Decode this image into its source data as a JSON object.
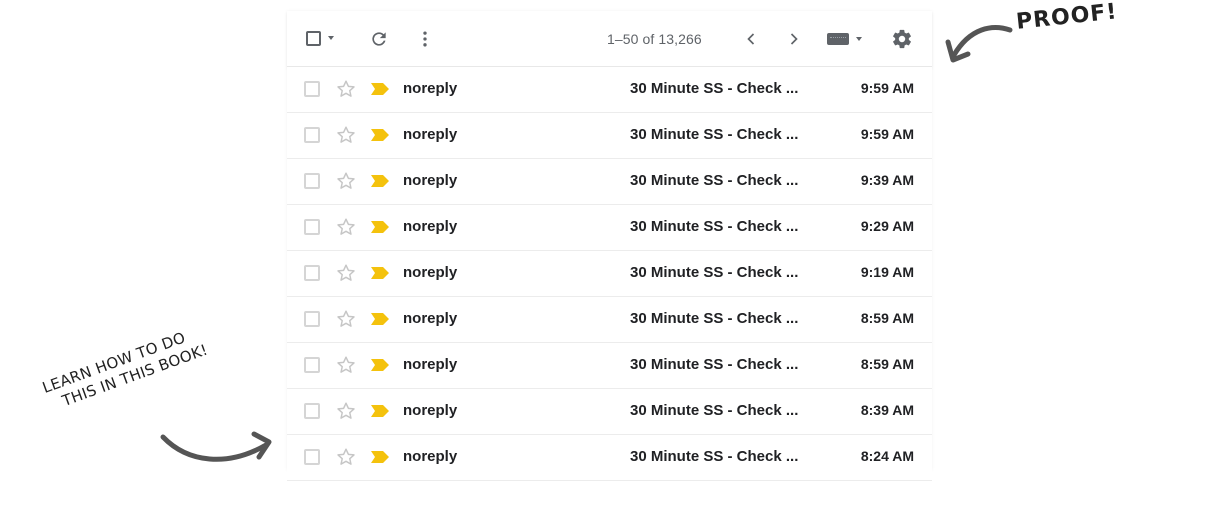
{
  "toolbar": {
    "page_count": "1–50 of 13,266",
    "icons": [
      "checkbox-icon",
      "dropdown-caret-icon",
      "refresh-icon",
      "more-vert-icon",
      "chevron-left-icon",
      "chevron-right-icon",
      "keyboard-icon",
      "gear-icon"
    ]
  },
  "emails": [
    {
      "sender": "noreply",
      "subject": "30 Minute SS - Check ...",
      "time": "9:59 AM"
    },
    {
      "sender": "noreply",
      "subject": "30 Minute SS - Check ...",
      "time": "9:59 AM"
    },
    {
      "sender": "noreply",
      "subject": "30 Minute SS - Check ...",
      "time": "9:39 AM"
    },
    {
      "sender": "noreply",
      "subject": "30 Minute SS - Check ...",
      "time": "9:29 AM"
    },
    {
      "sender": "noreply",
      "subject": "30 Minute SS - Check ...",
      "time": "9:19 AM"
    },
    {
      "sender": "noreply",
      "subject": "30 Minute SS - Check ...",
      "time": "8:59 AM"
    },
    {
      "sender": "noreply",
      "subject": "30 Minute SS - Check ...",
      "time": "8:59 AM"
    },
    {
      "sender": "noreply",
      "subject": "30 Minute SS - Check ...",
      "time": "8:39 AM"
    },
    {
      "sender": "noreply",
      "subject": "30 Minute SS - Check ...",
      "time": "8:24 AM"
    }
  ],
  "annotations": {
    "proof": "PROOF!",
    "learn_line1": "LEARN HOW TO DO",
    "learn_line2": "THIS IN THIS BOOK!"
  },
  "colors": {
    "importance_marker": "#f4c20d",
    "icon_gray": "#5f6368",
    "star_outline": "#c6c6c6"
  }
}
